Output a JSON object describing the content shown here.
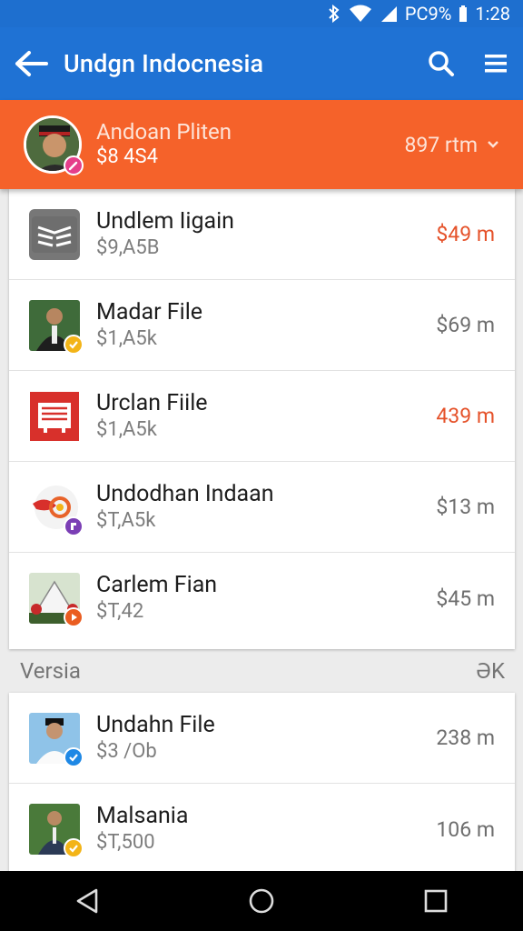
{
  "status_bar": {
    "battery": "PC9%",
    "time": "1:28"
  },
  "app_bar": {
    "title": "Undgn Indocnesia"
  },
  "featured": {
    "name": "Andoan Pliten",
    "subtitle": "$8 4S4",
    "amount": "897 rtm"
  },
  "list1": [
    {
      "name": "Undlem Iigain",
      "subtitle": "$9,A5B",
      "amount": "$49 m",
      "highlight": true
    },
    {
      "name": "Madar File",
      "subtitle": "$1,A5k",
      "amount": "$69 m",
      "highlight": false
    },
    {
      "name": "Urclan Fiile",
      "subtitle": "$1,A5k",
      "amount": "439 m",
      "highlight": true
    },
    {
      "name": "Undodhan Indaan",
      "subtitle": "$T,A5k",
      "amount": "$13 m",
      "highlight": false
    },
    {
      "name": "Carlem Fian",
      "subtitle": "$T,42",
      "amount": "$45 m",
      "highlight": false
    }
  ],
  "section": {
    "title": "Versia",
    "right": "ƏK"
  },
  "list2": [
    {
      "name": "Undahn File",
      "subtitle": "$3 /Ob",
      "amount": "238 m"
    },
    {
      "name": "Malsania",
      "subtitle": "$T,500",
      "amount": "106 m"
    }
  ],
  "icons": {
    "back": "arrow-left-icon",
    "search": "search-icon",
    "menu": "menu-icon",
    "nav_back": "nav-back-icon",
    "nav_home": "nav-home-icon",
    "nav_recent": "nav-recent-icon"
  },
  "colors": {
    "app_bar": "#1f72d4",
    "featured": "#f5622a",
    "accent_red": "#e5522a"
  }
}
